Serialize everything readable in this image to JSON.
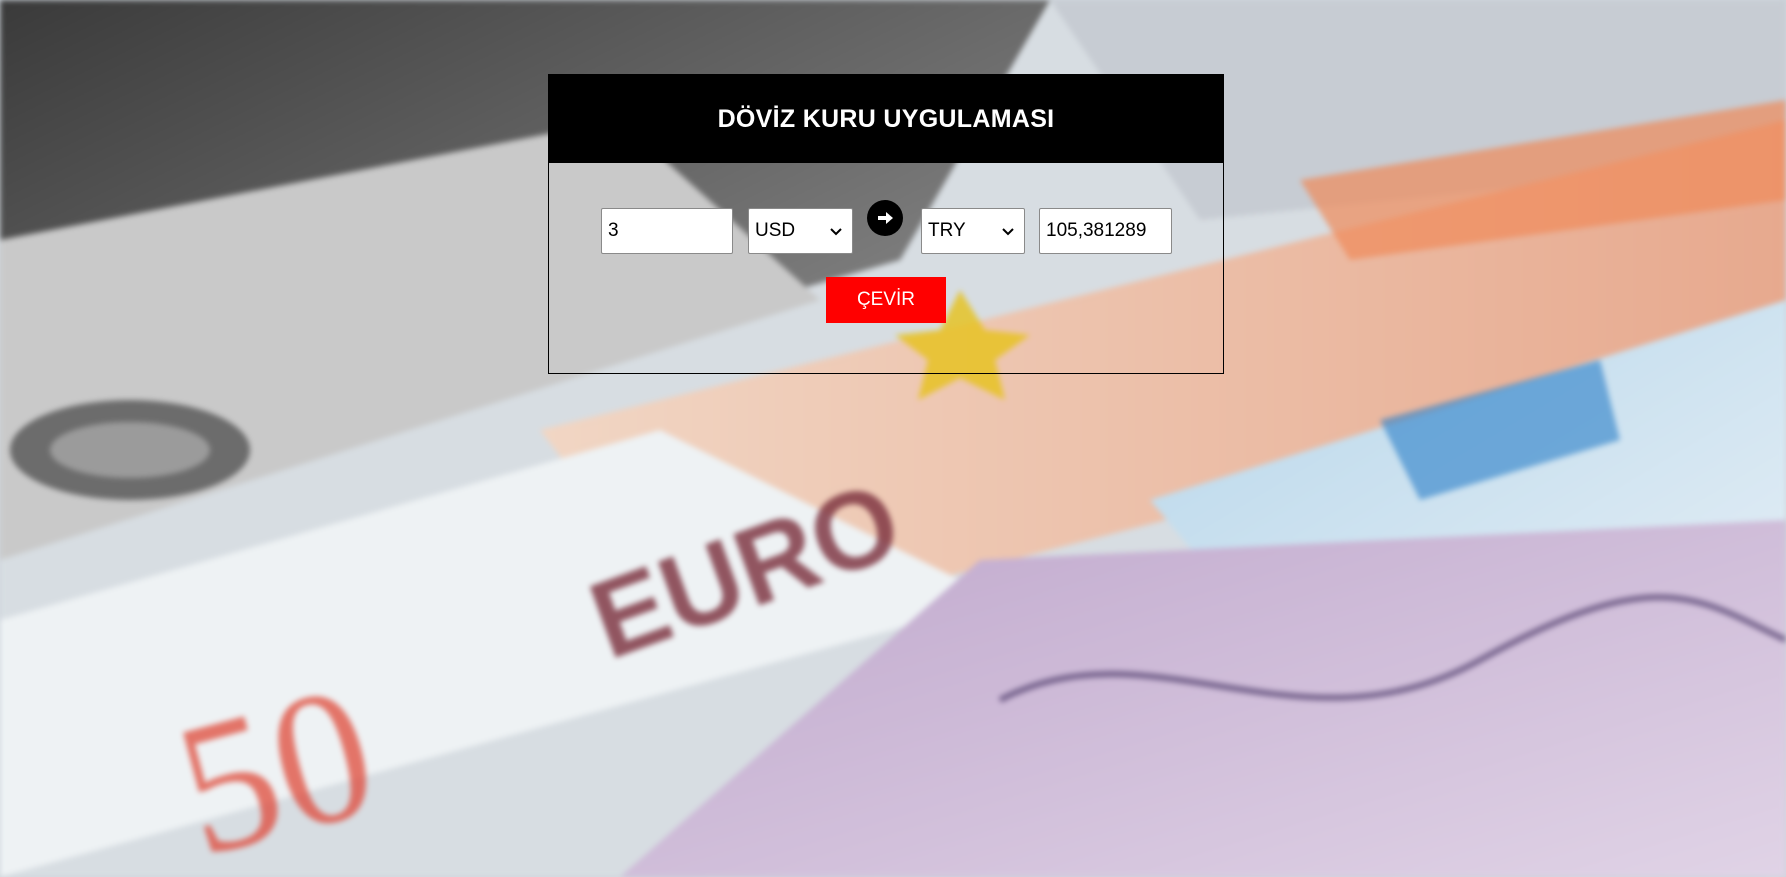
{
  "app": {
    "title": "DÖVİZ KURU UYGULAMASI"
  },
  "converter": {
    "amount": "3",
    "from_currency": "USD",
    "to_currency": "TRY",
    "result": "105,381289",
    "convert_label": "ÇEVİR",
    "swap_icon": "arrow-right-circle-icon"
  },
  "background": {
    "banknote_labels": [
      "EURO",
      "50"
    ]
  },
  "colors": {
    "header_bg": "#000000",
    "header_text": "#ffffff",
    "convert_button": "#ff0000"
  }
}
